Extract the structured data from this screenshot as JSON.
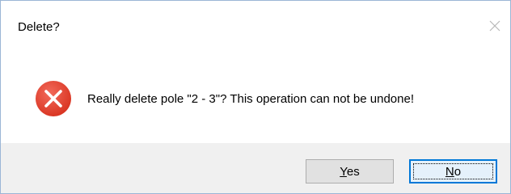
{
  "dialog": {
    "title": "Delete?",
    "message": "Really delete pole \"2 - 3\"?  This operation can not be undone!",
    "icon": "error-icon",
    "close_icon": "close-icon"
  },
  "buttons": {
    "yes": {
      "accel": "Y",
      "rest": "es"
    },
    "no": {
      "accel": "N",
      "rest": "o",
      "default": true
    }
  },
  "colors": {
    "error_red": "#e81123",
    "footer_bg": "#f0f0f0",
    "focus_border": "#0078d7"
  }
}
